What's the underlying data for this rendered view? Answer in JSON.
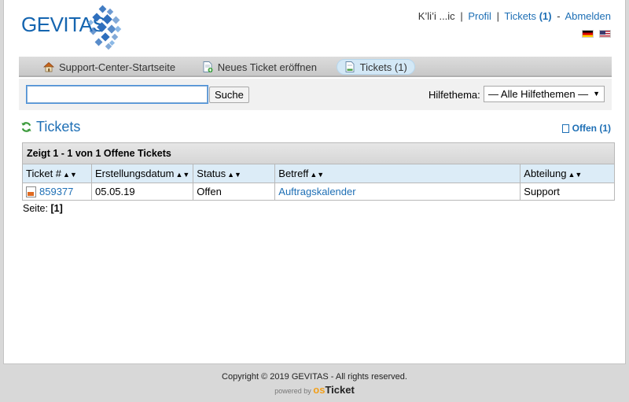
{
  "header": {
    "logo_text": "GEVITAS",
    "user_name": "K’li’i ...ic",
    "profile_link": "Profil",
    "tickets_link": "Tickets",
    "tickets_count": "(1)",
    "logout_link": "Abmelden",
    "separator_pipe": "|",
    "separator_dash": "-"
  },
  "nav": {
    "items": [
      {
        "label": "Support-Center-Startseite",
        "icon": "home-icon"
      },
      {
        "label": "Neues Ticket eröffnen",
        "icon": "new-ticket-icon"
      },
      {
        "label": "Tickets (1)",
        "icon": "tickets-icon",
        "active": true
      }
    ]
  },
  "search": {
    "value": "",
    "button_label": "Suche",
    "topic_label": "Hilfethema:",
    "topic_selected": "— Alle Hilfethemen —"
  },
  "tickets": {
    "heading": "Tickets",
    "filter_label": "Offen (1)",
    "caption": "Zeigt 1 - 1 von 1 Offene Tickets",
    "columns": [
      "Ticket #",
      "Erstellungsdatum",
      "Status",
      "Betreff",
      "Abteilung"
    ],
    "rows": [
      {
        "number": "859377",
        "date": "05.05.19",
        "status": "Offen",
        "subject": "Auftragskalender",
        "department": "Support"
      }
    ],
    "pager_label": "Seite:",
    "pager_current": "[1]"
  },
  "footer": {
    "copyright": "Copyright © 2019 GEVITAS - All rights reserved.",
    "powered_by": "powered by",
    "brand_os": "os",
    "brand_ticket": "Ticket"
  },
  "colors": {
    "link": "#1e6fb5",
    "nav_active_bg": "#d3e8f6",
    "table_header_bg": "#dcecf7"
  }
}
